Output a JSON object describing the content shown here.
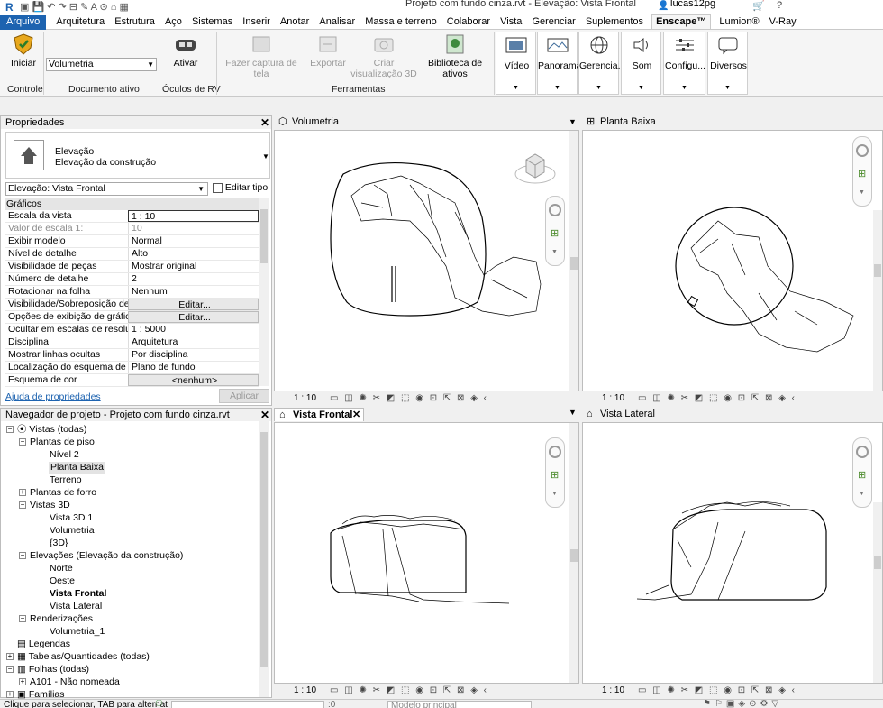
{
  "titlebar": {
    "title": "Projeto com fundo cinza.rvt - Elevação: Vista Frontal",
    "user": "lucas12pg"
  },
  "tabs": [
    "Arquivo",
    "Arquitetura",
    "Estrutura",
    "Aço",
    "Sistemas",
    "Inserir",
    "Anotar",
    "Analisar",
    "Massa e terreno",
    "Colaborar",
    "Vista",
    "Gerenciar",
    "Suplementos",
    "Enscape™",
    "Lumion®",
    "V-Ray"
  ],
  "ribbon": {
    "iniciar": "Iniciar",
    "volumetria": "Volumetria",
    "ativar": "Ativar",
    "fazer_captura": "Fazer captura de tela",
    "exportar": "Exportar",
    "criar_vis": "Criar visualização 3D",
    "biblioteca": "Biblioteca de ativos",
    "video": "Vídeo",
    "panorama": "Panorama",
    "gerenciar": "Gerencia...",
    "som": "Som",
    "config": "Configu...",
    "diversos": "Diversos",
    "panels": {
      "controle": "Controle",
      "documento": "Documento ativo",
      "oculos": "Óculos de RV",
      "ferramentas": "Ferramentas"
    }
  },
  "properties": {
    "title": "Propriedades",
    "type_line1": "Elevação",
    "type_line2": "Elevação da construção",
    "selector": "Elevação: Vista Frontal",
    "edit_type": "Editar tipo",
    "group": "Gráficos",
    "rows": [
      {
        "k": "Escala da vista",
        "v": "1 : 10"
      },
      {
        "k": "Valor de escala    1:",
        "v": "10"
      },
      {
        "k": "Exibir modelo",
        "v": "Normal"
      },
      {
        "k": "Nível de detalhe",
        "v": "Alto"
      },
      {
        "k": "Visibilidade de peças",
        "v": "Mostrar original"
      },
      {
        "k": "Número de detalhe",
        "v": "2"
      },
      {
        "k": "Rotacionar na folha",
        "v": "Nenhum"
      },
      {
        "k": "Visibilidade/Sobreposição de ...",
        "v": "Editar..."
      },
      {
        "k": "Opções de exibição de gráficos",
        "v": "Editar..."
      },
      {
        "k": "Ocultar em escalas de resoluç...",
        "v": "1 : 5000"
      },
      {
        "k": "Disciplina",
        "v": "Arquitetura"
      },
      {
        "k": "Mostrar linhas ocultas",
        "v": "Por disciplina"
      },
      {
        "k": "Localização do esquema de cor",
        "v": "Plano de fundo"
      },
      {
        "k": "Esquema de cor",
        "v": "<nenhum>"
      }
    ],
    "help": "Ajuda de propriedades",
    "apply": "Aplicar"
  },
  "browser": {
    "title": "Navegador de projeto - Projeto com fundo cinza.rvt",
    "items": [
      "Vistas (todas)",
      "Plantas de piso",
      "Nível 2",
      "Planta Baixa",
      "Terreno",
      "Plantas de forro",
      "Vistas 3D",
      "Vista 3D 1",
      "Volumetria",
      "{3D}",
      "Elevações (Elevação da construção)",
      "Norte",
      "Oeste",
      "Vista Frontal",
      "Vista Lateral",
      "Renderizações",
      "Volumetria_1",
      "Legendas",
      "Tabelas/Quantidades (todas)",
      "Folhas (todas)",
      "A101 - Não nomeada",
      "Famílias"
    ]
  },
  "views": {
    "tl": "Volumetria",
    "tr": "Planta Baixa",
    "bl": "Vista Frontal",
    "br": "Vista Lateral",
    "scale": "1 : 10"
  },
  "statusbar": {
    "hint": "Clique para selecionar, TAB para alternat",
    "zero": ":0",
    "model": "Modelo principal"
  }
}
